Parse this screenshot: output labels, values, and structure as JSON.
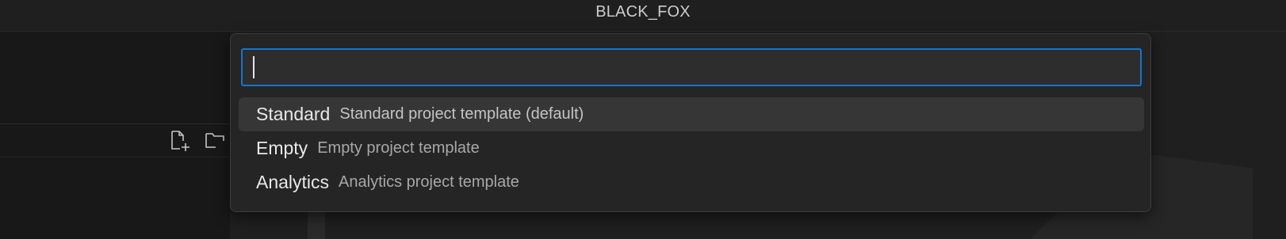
{
  "window": {
    "title": "BLACK_FOX"
  },
  "explorer": {
    "actions": [
      {
        "name": "new-file-icon"
      },
      {
        "name": "new-folder-icon"
      }
    ]
  },
  "quick_pick": {
    "input": {
      "value": "",
      "placeholder": ""
    },
    "accent_color": "#1a73c7",
    "items": [
      {
        "label": "Standard",
        "description": "Standard project template (default)",
        "selected": true
      },
      {
        "label": "Empty",
        "description": "Empty project template",
        "selected": false
      },
      {
        "label": "Analytics",
        "description": "Analytics project template",
        "selected": false
      }
    ]
  }
}
